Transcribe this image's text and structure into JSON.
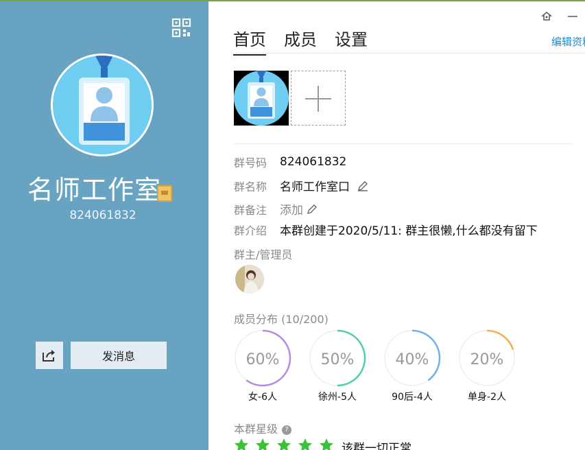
{
  "group": {
    "name": "名师工作室",
    "id": "824061832"
  },
  "left_actions": {
    "send_message": "发消息"
  },
  "tabs": [
    {
      "label": "首页",
      "active": true
    },
    {
      "label": "成员",
      "active": false
    },
    {
      "label": "设置",
      "active": false
    }
  ],
  "edit_profile_link": "编辑资料",
  "info": {
    "number_label": "群号码",
    "number_value": "824061832",
    "name_label": "群名称",
    "name_value": "名师工作室口",
    "remark_label": "群备注",
    "remark_value": "添加",
    "intro_label": "群介绍",
    "intro_value": "本群创建于2020/5/11:  群主很懒,什么都没有留下"
  },
  "admins_title": "群主/管理员",
  "distribution": {
    "title": "成员分布",
    "count": "(10/200)",
    "items": [
      {
        "percent": "60%",
        "fraction": 0.6,
        "label": "女-6人",
        "color": "#b48be3"
      },
      {
        "percent": "50%",
        "fraction": 0.5,
        "label": "徐州-5人",
        "color": "#4fd19a"
      },
      {
        "percent": "40%",
        "fraction": 0.4,
        "label": "90后-4人",
        "color": "#6fb0ee"
      },
      {
        "percent": "20%",
        "fraction": 0.2,
        "label": "单身-2人",
        "color": "#f5b04a"
      }
    ]
  },
  "rating": {
    "title": "本群星级",
    "stars": 5,
    "status": "该群一切正常"
  },
  "colors": {
    "left_panel": "#68a3c1",
    "accent_link": "#1a8bd6",
    "star": "#3cbf3c"
  }
}
